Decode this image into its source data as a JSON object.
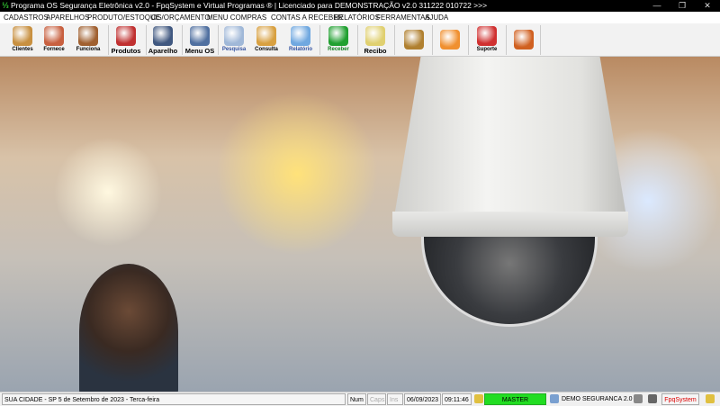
{
  "window": {
    "title": "Programa OS Segurança Eletrônica v2.0 - FpqSystem e Virtual Programas ® | Licenciado para  DEMONSTRAÇÃO v2.0 311222 010722 >>>",
    "minimize": "—",
    "restore": "❐",
    "close": "✕"
  },
  "menu": [
    "CADASTROS",
    "APARELHOS",
    "PRODUTO/ESTOQUE",
    "OS/ORÇAMENTO",
    "MENU COMPRAS",
    "CONTAS A RECEBER",
    "RELATÓRIOS",
    "FERRAMENTAS",
    "AJUDA"
  ],
  "toolbar": [
    {
      "label": "Clientes",
      "icon": "clients-icon",
      "color": "#c89040"
    },
    {
      "label": "Fornece",
      "icon": "supplier-icon",
      "color": "#c86040"
    },
    {
      "label": "Funciona",
      "icon": "employees-icon",
      "color": "#a06030"
    },
    {
      "label": "Produtos",
      "icon": "house-camera-icon",
      "color": "#c03030"
    },
    {
      "label": "Aparelho",
      "icon": "device-board-icon",
      "color": "#405880"
    },
    {
      "label": "Menu OS",
      "icon": "camera-icon",
      "color": "#5070a0"
    },
    {
      "label": "Pesquisa",
      "icon": "search-icon",
      "color": "#a0b8d8"
    },
    {
      "label": "Consulta",
      "icon": "folder-icon",
      "color": "#d8a040"
    },
    {
      "label": "Relatório",
      "icon": "printer-icon",
      "color": "#70a8e0"
    },
    {
      "label": "Receber",
      "icon": "dollar-icon",
      "color": "#20a030"
    },
    {
      "label": "Recibo",
      "icon": "receipt-icon",
      "color": "#e0d070"
    },
    {
      "label": "",
      "icon": "coin-icon",
      "color": "#b08030"
    },
    {
      "label": "",
      "icon": "calculator-icon",
      "color": "#f09030"
    },
    {
      "label": "Suporte",
      "icon": "support-icon",
      "color": "#d03030"
    },
    {
      "label": "",
      "icon": "exit-door-icon",
      "color": "#d06020"
    }
  ],
  "status": {
    "location": "SUA CIDADE - SP  5 de Setembro de 2023 - Terca-feira",
    "num": "Num",
    "caps": "Caps",
    "ins": "Ins",
    "date": "06/09/2023",
    "time": "09:11:46",
    "user": "MASTER",
    "company": "DEMO SEGURANCA 2.0",
    "brand": "FpqSystem",
    "user_color": "#22dd22",
    "brand_color": "#dd0000"
  }
}
